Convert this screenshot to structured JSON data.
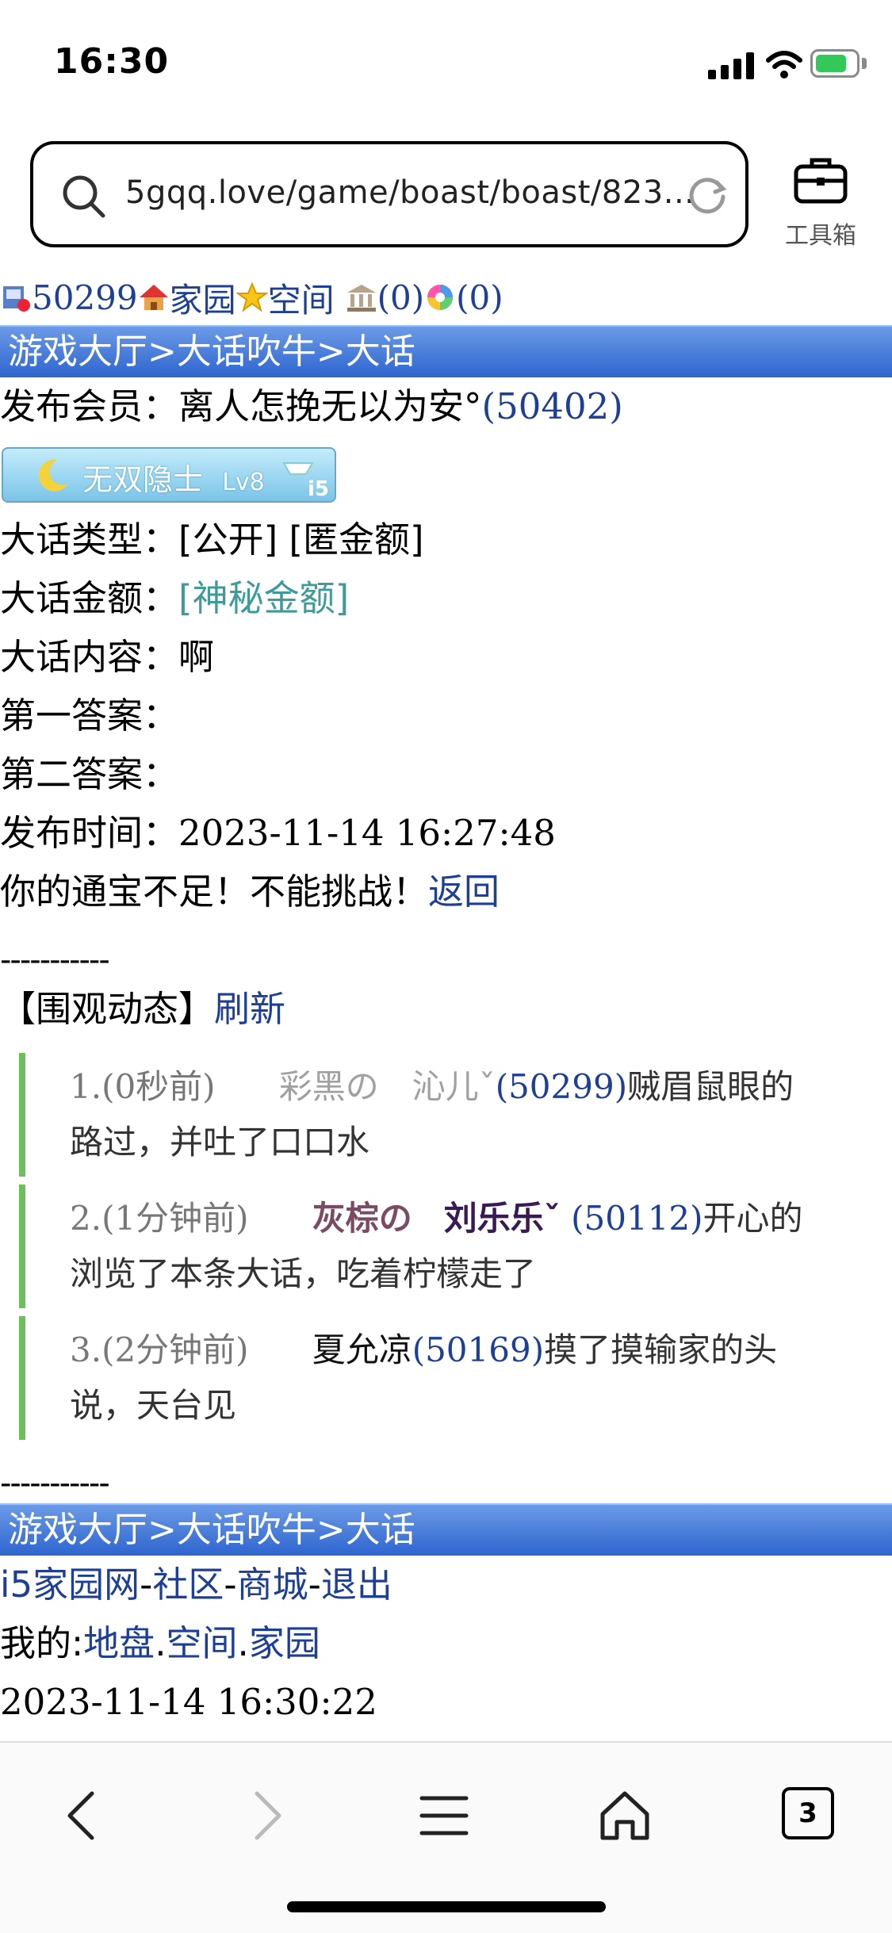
{
  "status": {
    "time": "16:30"
  },
  "browser": {
    "url": "5gqq.love/game/boast/boast/823...",
    "toolbox_label": "工具箱",
    "tab_count": "3"
  },
  "top_links": {
    "uid": "50299",
    "home": "家园",
    "space": "空间",
    "count1": "(0)",
    "count2": "(0)"
  },
  "breadcrumb": "游戏大厅>大话吹牛>大话",
  "detail": {
    "publisher_label": "发布会员：",
    "publisher_name": "离人怎挽无以为安°",
    "publisher_id": "(50402)",
    "medal_text": "无双隐士",
    "medal_level": "Lv8",
    "medal_badge": "i5",
    "type_label": "大话类型：",
    "type_value": "[公开] [匿金额]",
    "amount_label": "大话金额：",
    "amount_value": "[神秘金额]",
    "content_label": "大话内容：",
    "content_value": "啊",
    "answer1_label": "第一答案：",
    "answer2_label": "第二答案：",
    "time_label": "发布时间：",
    "time_value": "2023-11-14 16:27:48",
    "notice": "你的通宝不足！不能挑战！",
    "back_link": "返回"
  },
  "dashes": "-----------",
  "feed": {
    "title": "【围观动态】",
    "refresh": "刷新",
    "items": [
      {
        "prefix": "1.(0秒前)",
        "name": "彩黑の　沁儿ˇ",
        "id": "(50299)",
        "text_line1": "贼眉鼠眼的",
        "text_line2": "路过，并吐了口口水"
      },
      {
        "prefix": "2.(1分钟前)",
        "name_a": "灰棕の",
        "name_b": "刘乐乐ˇ",
        "id": "(50112)",
        "text_line1": "开心的",
        "text_line2": "浏览了本条大话，吃着柠檬走了"
      },
      {
        "prefix": "3.(2分钟前)",
        "name": "夏允凉",
        "id": "(50169)",
        "text_line1": "摸了摸输家的头",
        "text_line2": "说，天台见"
      }
    ]
  },
  "footer": {
    "breadcrumb": "游戏大厅>大话吹牛>大话",
    "links": [
      "i5家园网",
      "社区",
      "商城",
      "退出"
    ],
    "my_label": "我的:",
    "my_links": [
      "地盘",
      "空间",
      "家园"
    ],
    "timestamp": "2023-11-14 16:30:22"
  }
}
